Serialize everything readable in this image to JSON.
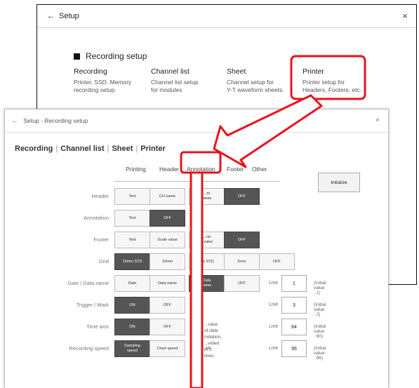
{
  "back_window": {
    "title": "Setup",
    "section": "Recording setup",
    "columns": [
      {
        "heading": "Recording",
        "desc1": "Printer, SSD, Memory",
        "desc2": "recording setup"
      },
      {
        "heading": "Channel list",
        "desc1": "Channel list setup",
        "desc2": "for modules"
      },
      {
        "heading": "Sheet",
        "desc1": "Channel setup for",
        "desc2": "Y-T waveform sheets."
      },
      {
        "heading": "Printer",
        "desc1": "Printer setup for",
        "desc2": "Headers, Footers, etc."
      }
    ]
  },
  "front_window": {
    "title": "Setup - Recording setup",
    "breadcrumb": [
      "Recording",
      "Channel list",
      "Sheet",
      "Printer"
    ],
    "tabs": [
      "Printing",
      "Header",
      "Annotation",
      "Footer",
      "Other"
    ],
    "initialize_label": "Initialize",
    "rows": {
      "header": {
        "label": "Header",
        "b1": "Text",
        "b2": "CH name",
        "b3": "...nt\nname",
        "b4": "OFF"
      },
      "annotation": {
        "label": "Annotation",
        "b1": "Text",
        "b2": "OFF"
      },
      "footer": {
        "label": "Footer",
        "b1": "Text",
        "b2": "Scale value",
        "b3": "...nd\n...value",
        "b4": "OFF"
      },
      "grid": {
        "label": "Grid",
        "b1": "10mm STD",
        "b2": "10mm",
        "b3": "...n STD",
        "b4": "2mm",
        "b5": "OFF"
      },
      "date": {
        "label": "Date / Data name",
        "b1": "Date",
        "b2": "Data name",
        "b3": "Data\nname",
        "b4": "OFF",
        "line_label": "Line",
        "line_value": "1",
        "initial": "(Initial value : 1)"
      },
      "trigger": {
        "label": "Trigger / Mark",
        "b1": "ON",
        "b2": "OFF",
        "line_label": "Line",
        "line_value": "3",
        "initial": "(Initial value : 2)"
      },
      "timeaxis": {
        "label": "Time axis",
        "b1": "ON",
        "b2": "OFF",
        "note1": "...case of date notation,",
        "note2": "...vided in 3 lines.",
        "line_label": "Line",
        "line_value": "84",
        "initial": "(Initial value : 80)"
      },
      "speed": {
        "label": "Recording speed",
        "b1": "Sampling\nspeed",
        "b2": "Chart speed",
        "b3": "...FF",
        "line_label": "Line",
        "line_value": "96",
        "initial": "(Initial value : 96)"
      }
    }
  },
  "colors": {
    "highlight": "#e8131b",
    "selected": "#555555"
  }
}
